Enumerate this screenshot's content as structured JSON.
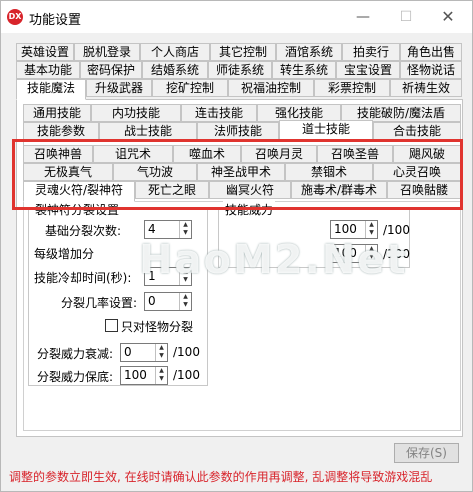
{
  "window": {
    "app_icon_text": "DX",
    "title": "功能设置",
    "minimize": "—",
    "maximize": "☐",
    "close": "✕"
  },
  "tabs_row1": [
    "英雄设置",
    "脱机登录",
    "个人商店",
    "其它控制",
    "酒馆系统",
    "拍卖行",
    "角色出售"
  ],
  "tabs_row2": [
    "基本功能",
    "密码保护",
    "结婚系统",
    "师徒系统",
    "转生系统",
    "宝宝设置",
    "怪物说话"
  ],
  "tabs_row3": [
    "技能魔法",
    "升级武器",
    "挖矿控制",
    "祝福油控制",
    "彩票控制",
    "祈祷生效"
  ],
  "tabs_row4": [
    "通用技能",
    "内功技能",
    "连击技能",
    "强化技能",
    "技能破防/魔法盾"
  ],
  "tabs_row5": [
    "技能参数",
    "战士技能",
    "法师技能",
    "道士技能",
    "合击技能"
  ],
  "tabs_row6": [
    "召唤神兽",
    "诅咒术",
    "噬血术",
    "召唤月灵",
    "召唤圣兽",
    "飓风破"
  ],
  "tabs_row7": [
    "无极真气",
    "气功波",
    "神圣战甲术",
    "禁锢术",
    "心灵召唤"
  ],
  "tabs_row8": [
    "灵魂火符/裂神符",
    "死亡之眼",
    "幽冥火符",
    "施毒术/群毒术",
    "召唤骷髅"
  ],
  "form": {
    "group_left_title": "裂神符分裂设置",
    "base_split_label": "基础分裂次数:",
    "base_split_value": "4",
    "per_level_label": "每级增加分",
    "cooldown_label": "技能冷却时间(秒):",
    "cooldown_value": "1",
    "split_chance_label": "分裂几率设置:",
    "split_chance_value": "0",
    "monster_only_label": "只对怪物分裂",
    "decay_label": "分裂威力衰减:",
    "decay_value": "0",
    "floor_label": "分裂威力保底:",
    "floor_value": "100",
    "slash100": "/100",
    "group_right_title": "技能威力",
    "right_value1": "100",
    "right_value2": "100",
    "right_slash": "/100"
  },
  "save_button": "保存(S)",
  "footer_note": "调整的参数立即生效, 在线时请确认此参数的作用再调整, 乱调整将导致游戏混乱",
  "watermark": "HaoM2.Net",
  "colors": {
    "highlight": "#e0342f",
    "footer_text": "#d8242b"
  }
}
